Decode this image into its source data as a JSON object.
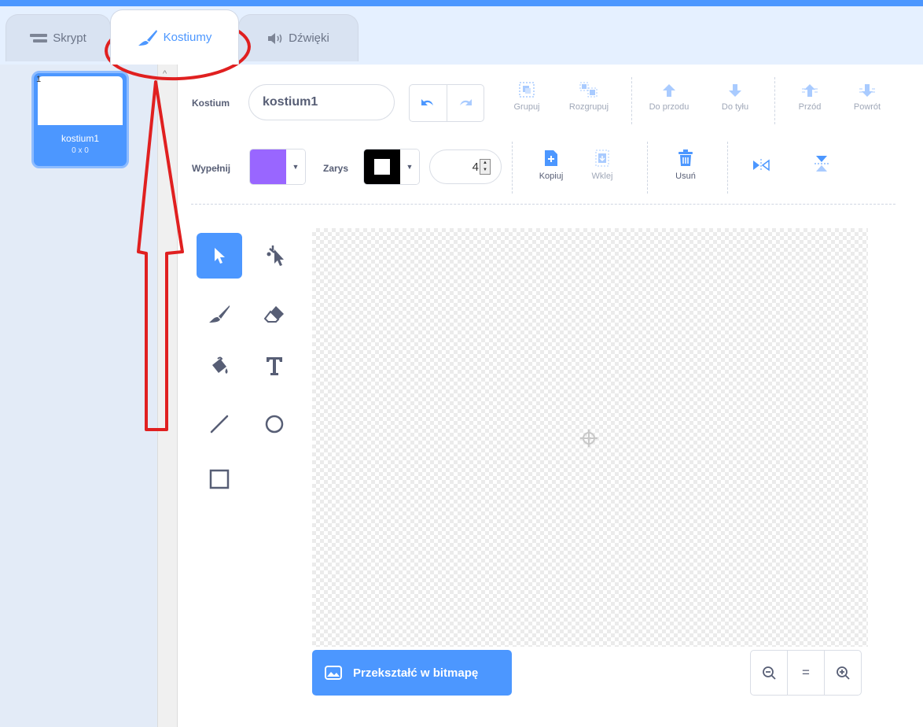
{
  "tabs": [
    {
      "label": "Skrypt",
      "icon": "code-icon"
    },
    {
      "label": "Kostiumy",
      "icon": "brush-icon",
      "active": true
    },
    {
      "label": "Dźwięki",
      "icon": "speaker-icon"
    }
  ],
  "costume_list": [
    {
      "number": "1",
      "name": "kostium1",
      "size": "0 x 0"
    }
  ],
  "toolbar": {
    "costume_label": "Kostium",
    "costume_name": "kostium1",
    "group": "Grupuj",
    "ungroup": "Rozgrupuj",
    "forward": "Do przodu",
    "backward": "Do tyłu",
    "front": "Przód",
    "back": "Powrót",
    "fill_label": "Wypełnij",
    "outline_label": "Zarys",
    "outline_width": "4",
    "copy": "Kopiuj",
    "paste": "Wklej",
    "delete": "Usuń"
  },
  "colors": {
    "fill": "#9966ff",
    "outline": "#000000",
    "accent": "#4c97ff",
    "annotation": "#e02020"
  },
  "tools": [
    "select-icon",
    "reshape-icon",
    "brush-icon",
    "eraser-icon",
    "fill-icon",
    "text-icon",
    "line-icon",
    "circle-icon",
    "rectangle-icon"
  ],
  "bottom": {
    "convert_button": "Przekształć w bitmapę",
    "zoom_in": "zoom-in-icon",
    "zoom_reset": "=",
    "zoom_out": "zoom-out-icon"
  }
}
